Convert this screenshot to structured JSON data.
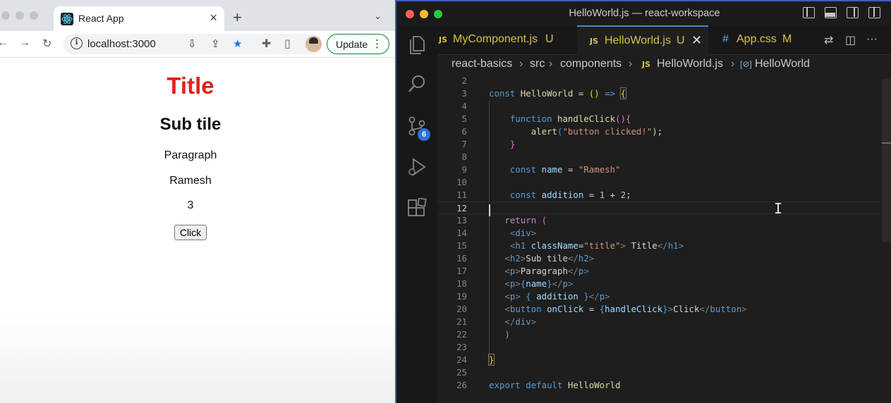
{
  "browser": {
    "tab_title": "React App",
    "url": "localhost:3000",
    "update_label": "Update",
    "page": {
      "h1": "Title",
      "h2": "Sub tile",
      "p1": "Paragraph",
      "p2": "Ramesh",
      "p3": "3",
      "button": "Click"
    },
    "colors": {
      "title_red": "#e2231a"
    }
  },
  "vscode": {
    "window_title": "HelloWorld.js — react-workspace",
    "tabs": [
      {
        "prefix": "JS",
        "name": "MyComponent.js",
        "status": "U"
      },
      {
        "prefix": "JS",
        "name": "HelloWorld.js",
        "status": "U"
      },
      {
        "prefix": "#",
        "name": "App.css",
        "status": "M"
      }
    ],
    "breadcrumbs": [
      "react-basics",
      "src",
      "components",
      "HelloWorld.js",
      "HelloWorld"
    ],
    "breadcrumb_file_prefix": "JS",
    "source_control_badge": "6",
    "line_numbers": [
      "2",
      "3",
      "4",
      "5",
      "6",
      "7",
      "8",
      "9",
      "10",
      "11",
      "12",
      "13",
      "14",
      "15",
      "16",
      "17",
      "18",
      "19",
      "20",
      "21",
      "22",
      "23",
      "24",
      "25",
      "26"
    ],
    "code": {
      "l3": [
        "const",
        "HelloWorld",
        "=",
        "()",
        "=>",
        "{"
      ],
      "l5": [
        "function",
        "handleClick",
        "(){"
      ],
      "l6": [
        "alert",
        "(",
        "\"button clicked!\"",
        ");"
      ],
      "l7": [
        "}"
      ],
      "l9": [
        "const",
        "name",
        "=",
        "\"Ramesh\""
      ],
      "l11": [
        "const",
        "addition",
        "=",
        "1",
        "+",
        "2",
        ";"
      ],
      "l13": [
        "return",
        "("
      ],
      "l14": [
        "<",
        "div",
        ">"
      ],
      "l15": [
        "<",
        "h1",
        "className",
        "=",
        "\"title\"",
        ">",
        " Title",
        "</",
        "h1",
        ">"
      ],
      "l16": [
        "<",
        "h2",
        ">",
        "Sub tile",
        "</",
        "h2",
        ">"
      ],
      "l17": [
        "<",
        "p",
        ">",
        "Paragraph",
        "</",
        "p",
        ">"
      ],
      "l18": [
        "<",
        "p",
        ">",
        "{",
        "name",
        "}",
        "</",
        "p",
        ">"
      ],
      "l19": [
        "<",
        "p",
        ">",
        " { ",
        "addition",
        " }",
        "</",
        "p",
        ">"
      ],
      "l20": [
        "<",
        "button",
        "onClick",
        " = ",
        "{",
        "handleClick",
        "}",
        ">",
        "Click",
        "</",
        "button",
        ">"
      ],
      "l21": [
        "</",
        "div",
        ">"
      ],
      "l22": [
        ")"
      ],
      "l24": [
        "}"
      ],
      "l26": [
        "export",
        "default",
        "HelloWorld"
      ]
    },
    "colors": {
      "accent": "#3c8ddc",
      "keyword": "#569cd6",
      "string": "#ce9178",
      "function": "#dcdcaa",
      "variable": "#9cdcfe"
    }
  }
}
